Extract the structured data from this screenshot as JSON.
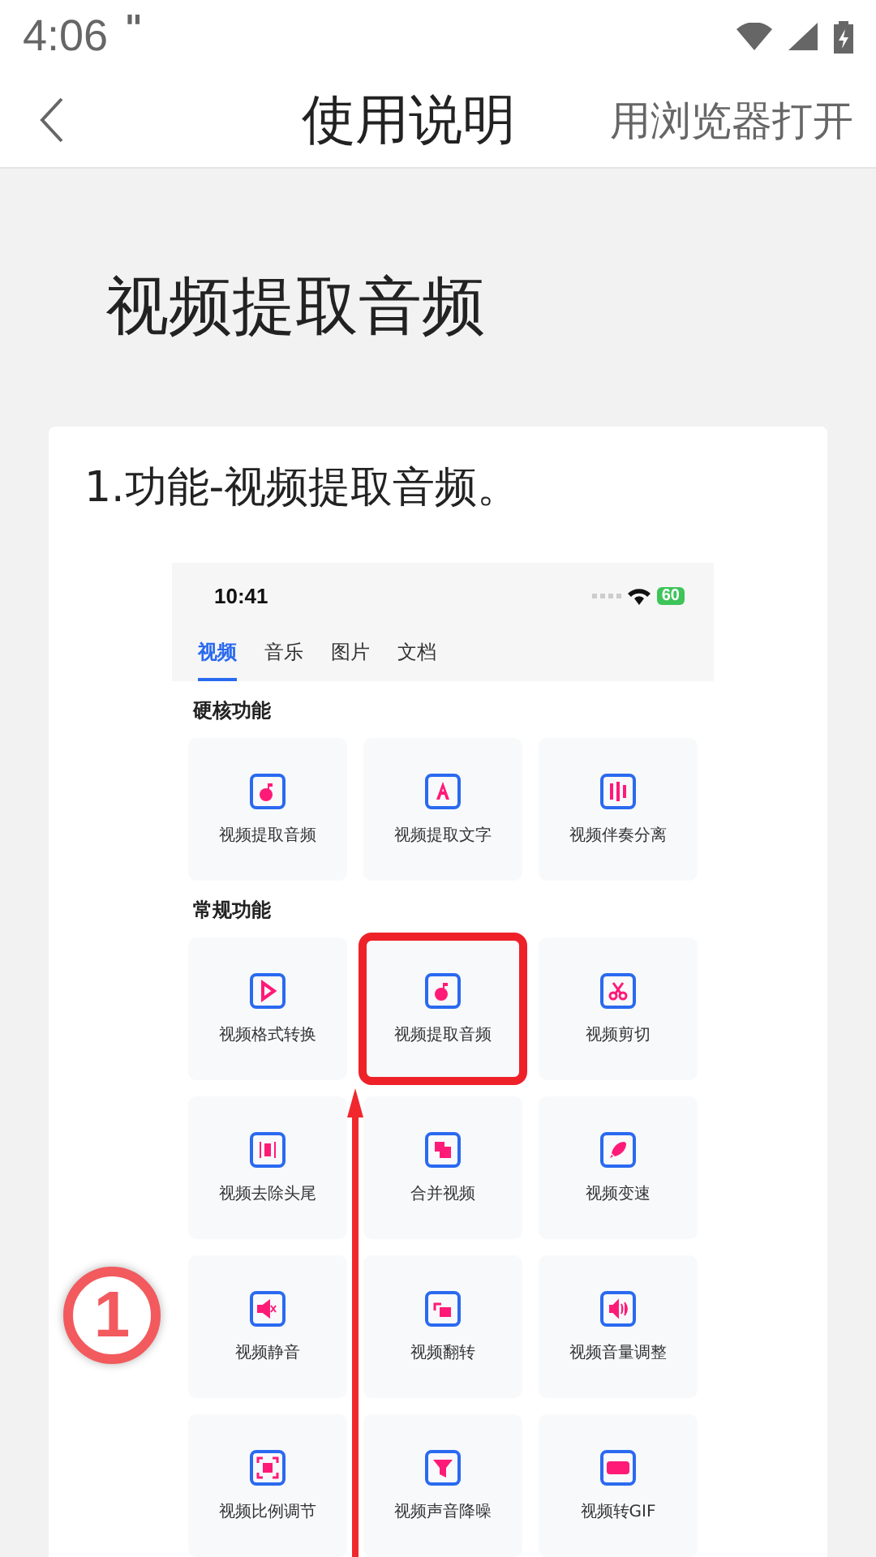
{
  "status_bar": {
    "time": "4:06",
    "notification": "\""
  },
  "header": {
    "title": "使用说明",
    "action": "用浏览器打开"
  },
  "article": {
    "title": "视频提取音频",
    "step": {
      "text": "1.功能-视频提取音频。",
      "screenshot": {
        "time": "10:41",
        "battery": "60",
        "tabs": [
          {
            "label": "视频",
            "selected": true
          },
          {
            "label": "音乐",
            "selected": false
          },
          {
            "label": "图片",
            "selected": false
          },
          {
            "label": "文档",
            "selected": false
          }
        ],
        "sections": [
          {
            "title": "硬核功能",
            "items": [
              {
                "label": "视频提取音频",
                "highlighted": false
              },
              {
                "label": "视频提取文字",
                "highlighted": false
              },
              {
                "label": "视频伴奏分离",
                "highlighted": false
              }
            ]
          },
          {
            "title": "常规功能",
            "items": [
              {
                "label": "视频格式转换",
                "highlighted": false
              },
              {
                "label": "视频提取音频",
                "highlighted": true
              },
              {
                "label": "视频剪切",
                "highlighted": false
              },
              {
                "label": "视频去除头尾",
                "highlighted": false
              },
              {
                "label": "合并视频",
                "highlighted": false
              },
              {
                "label": "视频变速",
                "highlighted": false
              },
              {
                "label": "视频静音",
                "highlighted": false
              },
              {
                "label": "视频翻转",
                "highlighted": false
              },
              {
                "label": "视频音量调整",
                "highlighted": false
              },
              {
                "label": "视频比例调节",
                "highlighted": false
              },
              {
                "label": "视频声音降噪",
                "highlighted": false
              },
              {
                "label": "视频转GIF",
                "highlighted": false
              }
            ]
          }
        ],
        "step_marker": "1"
      }
    }
  }
}
